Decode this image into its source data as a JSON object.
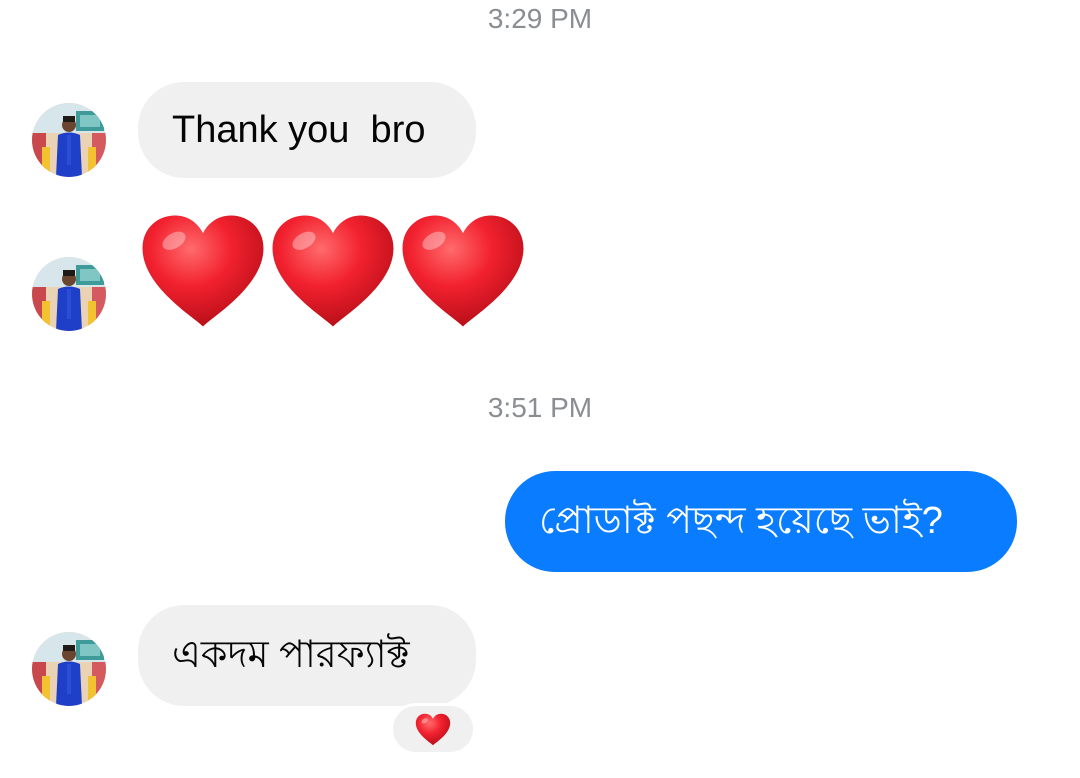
{
  "conversation": {
    "timestamps": [
      "3:29 PM",
      "3:51 PM"
    ],
    "messages": [
      {
        "sender": "contact",
        "text": "Thank you  bro"
      },
      {
        "sender": "contact",
        "emoji": "red-heart",
        "count": 3
      },
      {
        "sender": "me",
        "text": "প্রোডাক্ট পছন্দ হয়েছে ভাই?"
      },
      {
        "sender": "contact",
        "text": "একদম পারফ্যাক্ট",
        "reaction": "red-heart"
      }
    ]
  },
  "colors": {
    "incoming_bubble": "#f0f0f0",
    "outgoing_bubble": "#0a7cff",
    "timestamp_text": "#8a8d91",
    "heart": "#e8172b"
  }
}
